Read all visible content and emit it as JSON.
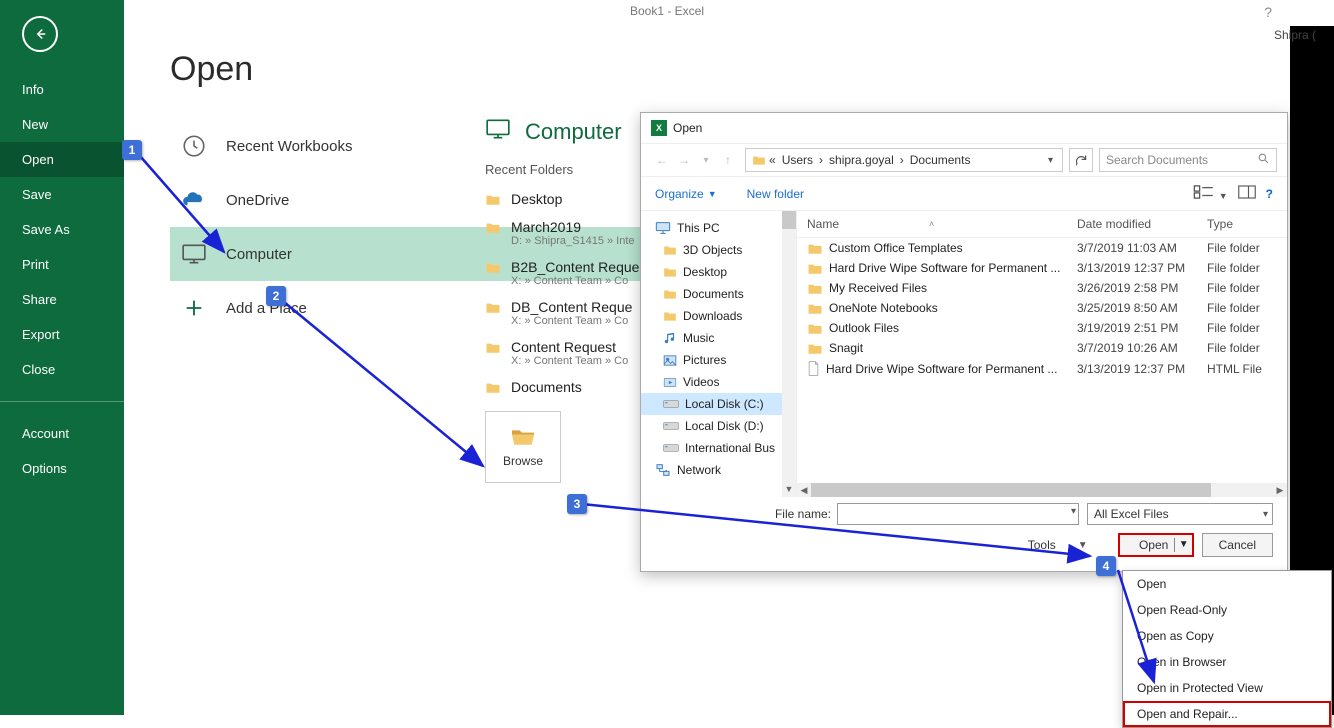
{
  "titlebar": {
    "doc": "Book1 - Excel",
    "user": "Shipra (",
    "help": "?"
  },
  "backstage": {
    "items": [
      "Info",
      "New",
      "Open",
      "Save",
      "Save As",
      "Print",
      "Share",
      "Export",
      "Close"
    ],
    "items2": [
      "Account",
      "Options"
    ],
    "selected": "Open"
  },
  "open": {
    "title": "Open",
    "sources": {
      "recent": "Recent Workbooks",
      "onedrive": "OneDrive",
      "computer": "Computer",
      "add": "Add a Place"
    },
    "location_title": "Computer",
    "recent_folders_head": "Recent Folders",
    "recent_folders": [
      {
        "name": "Desktop",
        "sub": ""
      },
      {
        "name": "March2019",
        "sub": "D: » Shipra_S1415 » Inte"
      },
      {
        "name": "B2B_Content Reque",
        "sub": "X: » Content Team » Co"
      },
      {
        "name": "DB_Content Reque",
        "sub": "X: » Content Team » Co"
      },
      {
        "name": "Content Request",
        "sub": "X: » Content Team » Co"
      },
      {
        "name": "Documents",
        "sub": ""
      }
    ],
    "browse": "Browse"
  },
  "dialog": {
    "title": "Open",
    "crumb_prefix": "«",
    "crumbs": [
      "Users",
      "shipra.goyal",
      "Documents"
    ],
    "search_placeholder": "Search Documents",
    "organize": "Organize",
    "newfolder": "New folder",
    "tree": [
      {
        "label": "This PC",
        "hdr": true
      },
      {
        "label": "3D Objects"
      },
      {
        "label": "Desktop"
      },
      {
        "label": "Documents"
      },
      {
        "label": "Downloads"
      },
      {
        "label": "Music"
      },
      {
        "label": "Pictures"
      },
      {
        "label": "Videos"
      },
      {
        "label": "Local Disk (C:)",
        "sel": true
      },
      {
        "label": "Local Disk (D:)"
      },
      {
        "label": "International Bus"
      },
      {
        "label": "Network",
        "hdr": true
      }
    ],
    "cols": {
      "name": "Name",
      "date": "Date modified",
      "type": "Type"
    },
    "files": [
      {
        "name": "Custom Office Templates",
        "date": "3/7/2019 11:03 AM",
        "type": "File folder",
        "kind": "folder"
      },
      {
        "name": "Hard Drive Wipe Software for Permanent ...",
        "date": "3/13/2019 12:37 PM",
        "type": "File folder",
        "kind": "folder"
      },
      {
        "name": "My Received Files",
        "date": "3/26/2019 2:58 PM",
        "type": "File folder",
        "kind": "folder"
      },
      {
        "name": "OneNote Notebooks",
        "date": "3/25/2019 8:50 AM",
        "type": "File folder",
        "kind": "folder"
      },
      {
        "name": "Outlook Files",
        "date": "3/19/2019 2:51 PM",
        "type": "File folder",
        "kind": "folder"
      },
      {
        "name": "Snagit",
        "date": "3/7/2019 10:26 AM",
        "type": "File folder",
        "kind": "folder"
      },
      {
        "name": "Hard Drive Wipe Software for Permanent ...",
        "date": "3/13/2019 12:37 PM",
        "type": "HTML File",
        "kind": "file"
      }
    ],
    "file_name_label": "File name:",
    "filter": "All Excel Files",
    "tools": "Tools",
    "open_btn": "Open",
    "cancel_btn": "Cancel",
    "open_menu": [
      "Open",
      "Open Read-Only",
      "Open as Copy",
      "Open in Browser",
      "Open in Protected View",
      "Open and Repair..."
    ]
  },
  "callouts": {
    "c1": "1",
    "c2": "2",
    "c3": "3",
    "c4": "4"
  }
}
